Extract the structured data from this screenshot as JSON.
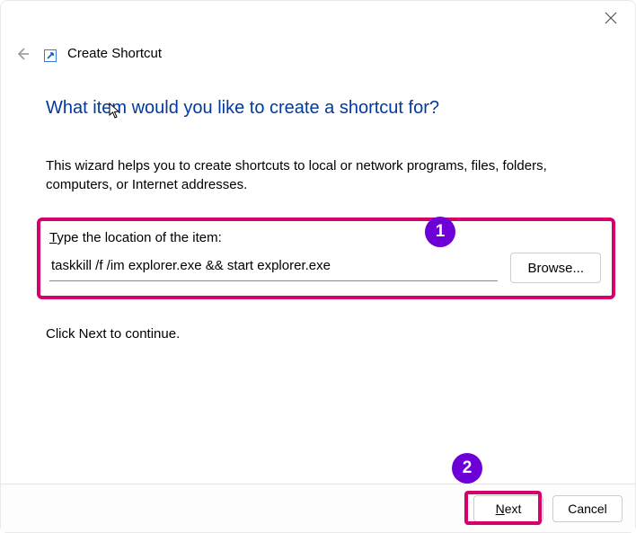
{
  "window": {
    "title": "Create Shortcut"
  },
  "heading": "What item would you like to create a shortcut for?",
  "description": "This wizard helps you to create shortcuts to local or network programs, files, folders, computers, or Internet addresses.",
  "location": {
    "label_prefix_ul": "T",
    "label_rest": "ype the location of the item:",
    "value": "taskkill /f /im explorer.exe && start explorer.exe",
    "browse": "Browse..."
  },
  "continue_text": "Click Next to continue.",
  "footer": {
    "next_ul": "N",
    "next_rest": "ext",
    "cancel": "Cancel"
  },
  "callouts": {
    "one": "1",
    "two": "2"
  }
}
